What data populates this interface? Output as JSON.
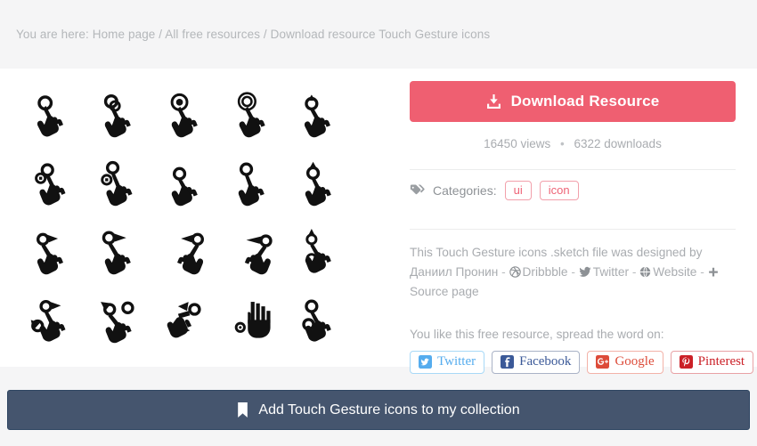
{
  "breadcrumb": {
    "text": "You are here: Home page / All free resources / Download resource Touch Gesture icons"
  },
  "preview": {
    "icons": [
      {
        "name": "tap-icon",
        "label": "tap"
      },
      {
        "name": "tap-hold-icon",
        "label": "tap hold"
      },
      {
        "name": "double-tap-icon",
        "label": "double tap"
      },
      {
        "name": "tap-ripple-icon",
        "label": "tap ripple"
      },
      {
        "name": "swipe-up-icon",
        "label": "swipe up"
      },
      {
        "name": "drag-down-icon",
        "label": "drag down"
      },
      {
        "name": "drag-double-icon",
        "label": "drag double"
      },
      {
        "name": "swipe-left-icon",
        "label": "swipe left"
      },
      {
        "name": "swipe-right-icon",
        "label": "swipe right"
      },
      {
        "name": "swipe-vertical-icon",
        "label": "swipe vertical"
      },
      {
        "name": "flick-left-icon",
        "label": "flick left"
      },
      {
        "name": "flick-up-icon",
        "label": "flick up"
      },
      {
        "name": "flick-right-icon",
        "label": "flick right"
      },
      {
        "name": "two-finger-drag-icon",
        "label": "two finger drag"
      },
      {
        "name": "pinch-vertical-icon",
        "label": "pinch vertical"
      },
      {
        "name": "pinch-in-icon",
        "label": "pinch in"
      },
      {
        "name": "pinch-out-icon",
        "label": "pinch out"
      },
      {
        "name": "rotate-icon",
        "label": "rotate"
      },
      {
        "name": "open-palm-icon",
        "label": "open palm"
      },
      {
        "name": "two-finger-tap-icon",
        "label": "two finger tap"
      }
    ]
  },
  "download": {
    "button_label": "Download Resource",
    "icon": "download-icon",
    "color": "#ef5f71",
    "views": "16450 views",
    "separator": "•",
    "downloads": "6322 downloads"
  },
  "categories": {
    "icon": "tag-icon",
    "label": "Categories:",
    "items": [
      {
        "label": "ui"
      },
      {
        "label": "icon"
      }
    ]
  },
  "description": {
    "prefix": "This Touch Gesture icons .sketch file was designed by ",
    "author": "Даниил Пронин",
    "dash": "-",
    "links": [
      {
        "label": "Dribbble",
        "icon": "dribbble-icon"
      },
      {
        "label": "Twitter",
        "icon": "twitter-icon"
      },
      {
        "label": "Website",
        "icon": "globe-icon"
      },
      {
        "label": "Source page",
        "icon": "plus-icon"
      }
    ]
  },
  "share": {
    "prompt": "You like this free resource, spread the word on:",
    "buttons": [
      {
        "label": "Twitter",
        "icon": "twitter-icon",
        "color": "#55acee"
      },
      {
        "label": "Facebook",
        "icon": "facebook-icon",
        "color": "#3b5998"
      },
      {
        "label": "Google",
        "icon": "google-plus-icon",
        "color": "#dd4b39"
      },
      {
        "label": "Pinterest",
        "icon": "pinterest-icon",
        "color": "#cb2027"
      }
    ]
  },
  "collection": {
    "icon": "bookmark-icon",
    "label": "Add Touch Gesture icons to my collection",
    "color": "#45556e"
  }
}
